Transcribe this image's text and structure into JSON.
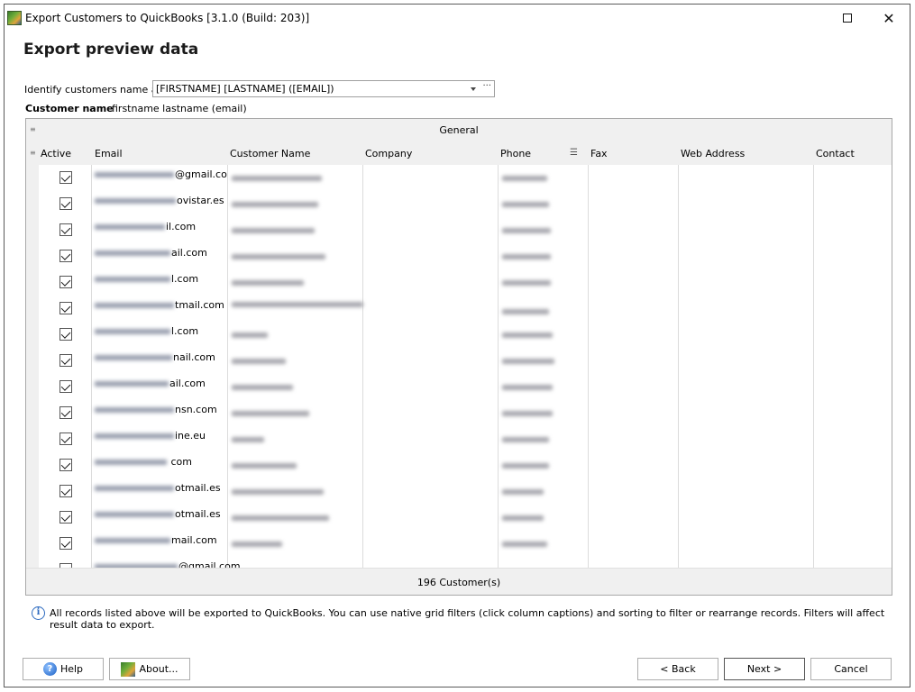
{
  "window": {
    "title": "Export Customers to QuickBooks [3.1.0 (Build: 203)]",
    "maximize_icon": "maximize-icon",
    "close_icon": "close-icon"
  },
  "page": {
    "title": "Export preview data"
  },
  "identify": {
    "label": "Identify customers name as",
    "value": "[FIRSTNAME] [LASTNAME] ([EMAIL])",
    "ellipsis": "···"
  },
  "customer_name": {
    "label": "Customer name",
    "value": "firstname lastname (email)"
  },
  "grid": {
    "band_label": "General",
    "columns": [
      "Active",
      "Email",
      "Customer Name",
      "Company",
      "Phone",
      "Fax",
      "Web Address",
      "Contact"
    ],
    "rows": [
      {
        "active": true,
        "email_visible": "@gmail.co",
        "email_hidden": true
      },
      {
        "active": true,
        "email_visible": "ovistar.es",
        "email_hidden": true
      },
      {
        "active": true,
        "email_visible": "il.com",
        "email_hidden": true
      },
      {
        "active": true,
        "email_visible": "ail.com",
        "email_hidden": true
      },
      {
        "active": true,
        "email_visible": "l.com",
        "email_hidden": true
      },
      {
        "active": true,
        "email_visible": "tmail.com",
        "email_hidden": true
      },
      {
        "active": true,
        "email_visible": "l.com",
        "email_hidden": true
      },
      {
        "active": true,
        "email_visible": "nail.com",
        "email_hidden": true
      },
      {
        "active": true,
        "email_visible": "ail.com",
        "email_hidden": true
      },
      {
        "active": true,
        "email_visible": "nsn.com",
        "email_hidden": true
      },
      {
        "active": true,
        "email_visible": "ine.eu",
        "email_hidden": true
      },
      {
        "active": true,
        "email_visible": " com",
        "email_hidden": true
      },
      {
        "active": true,
        "email_visible": "otmail.es",
        "email_hidden": true
      },
      {
        "active": true,
        "email_visible": "otmail.es",
        "email_hidden": true
      },
      {
        "active": true,
        "email_visible": "mail.com",
        "email_hidden": true
      },
      {
        "active": true,
        "email_visible": "@gmail.com",
        "email_hidden": true
      }
    ],
    "footer": "196 Customer(s)"
  },
  "info": {
    "icon": "info-icon",
    "text": "All records listed above will be exported to QuickBooks. You can use native grid filters (click column captions) and sorting to filter or rearrange records. Filters will affect result data to export."
  },
  "buttons": {
    "help": "Help",
    "about": "About...",
    "back": "< Back",
    "next": "Next >",
    "cancel": "Cancel"
  }
}
